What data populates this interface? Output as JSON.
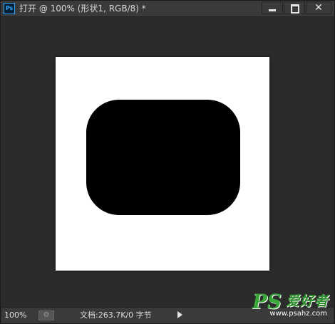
{
  "window": {
    "app_icon": "Ps",
    "title": "打开 @ 100% (形状1, RGB/8) *",
    "controls": {
      "minimize": "minimize-icon",
      "maximize": "maximize-icon",
      "close": "close-icon",
      "close_glyph": "✕"
    }
  },
  "canvas": {
    "document_color": "#ffffff",
    "shape": {
      "type": "rounded-rectangle",
      "fill": "#000000"
    }
  },
  "statusbar": {
    "zoom": "100%",
    "doc_info": "文档:263.7K/0 字节",
    "play_icon": "play-icon"
  },
  "watermark": {
    "logo": "PS",
    "site_name": "爱好者",
    "url": "www.psahz.com"
  }
}
